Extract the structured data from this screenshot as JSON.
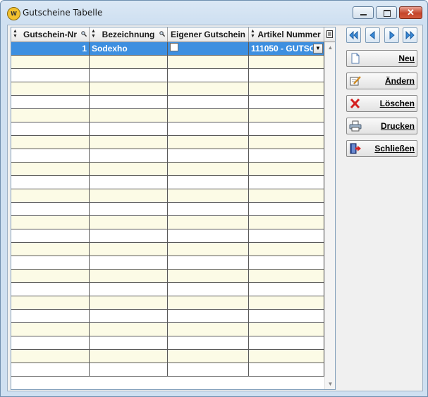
{
  "window": {
    "title": "Gutscheine Tabelle",
    "icon": "app-logo-icon"
  },
  "grid": {
    "columns": [
      "Gutschein-Nr",
      "Bezeichnung",
      "Eigener Gutschein",
      "Artikel Nummer"
    ],
    "rows": [
      {
        "nr": "1",
        "bezeichnung": "Sodexho",
        "eigener": false,
        "artikel": "111050 - GUTSC"
      }
    ],
    "empty_row_count": 24
  },
  "nav": {
    "first": "first-record-icon",
    "prev": "prev-record-icon",
    "next": "next-record-icon",
    "last": "last-record-icon"
  },
  "actions": {
    "neu": "Neu",
    "aendern": "Ändern",
    "loeschen": "Löschen",
    "drucken": "Drucken",
    "schliessen": "Schließen"
  },
  "colors": {
    "selected_row": "#3d8fe0",
    "alt_row": "#fcfbe6",
    "accent": "#2a7fd4"
  }
}
